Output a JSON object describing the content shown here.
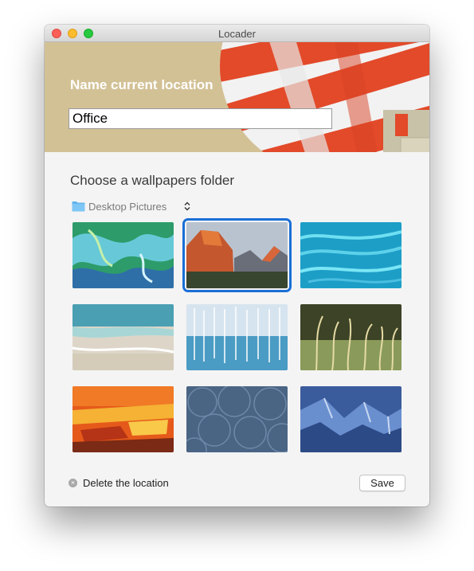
{
  "window": {
    "title": "Locader"
  },
  "header": {
    "title": "Name current location",
    "location_name_value": "Office"
  },
  "wallpapers": {
    "title": "Choose a wallpapers folder",
    "folder_selected": "Desktop Pictures",
    "selected_index": 1,
    "thumbnails": [
      {
        "name": "green-marbled-abstract"
      },
      {
        "name": "el-capitan-mountains"
      },
      {
        "name": "turquoise-water-ripples"
      },
      {
        "name": "beach-shoreline"
      },
      {
        "name": "blue-lake-trees"
      },
      {
        "name": "grass-field"
      },
      {
        "name": "orange-painted-abstract"
      },
      {
        "name": "blue-scale-pattern"
      },
      {
        "name": "blue-rock-formation"
      }
    ]
  },
  "footer": {
    "delete_label": "Delete the location",
    "save_label": "Save"
  },
  "colors": {
    "header_background": "#d3c196",
    "selection_accent": "#1a6fd6",
    "window_background": "#f4f4f4"
  }
}
